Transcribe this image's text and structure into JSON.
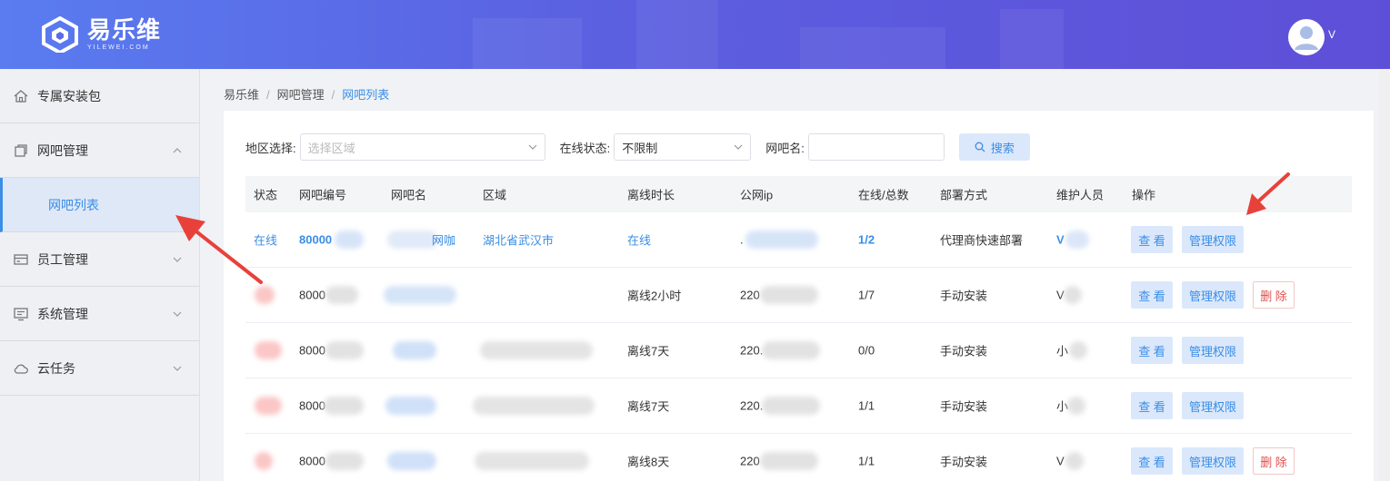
{
  "header": {
    "logo_cn": "易乐维",
    "logo_en": "YILEWEI.COM",
    "user_name": "V"
  },
  "sidebar": {
    "items": [
      {
        "label": "专属安装包",
        "icon": "home-icon"
      },
      {
        "label": "网吧管理",
        "icon": "window-icon",
        "expanded": true
      },
      {
        "label": "员工管理",
        "icon": "card-icon"
      },
      {
        "label": "系统管理",
        "icon": "monitor-icon"
      },
      {
        "label": "云任务",
        "icon": "cloud-icon"
      }
    ],
    "sub_item": "网吧列表"
  },
  "breadcrumb": [
    "易乐维",
    "网吧管理",
    "网吧列表"
  ],
  "filters": {
    "region_label": "地区选择:",
    "region_placeholder": "选择区域",
    "status_label": "在线状态:",
    "status_value": "不限制",
    "name_label": "网吧名:",
    "search_label": "搜索"
  },
  "table": {
    "headers": [
      "状态",
      "网吧编号",
      "网吧名",
      "区域",
      "离线时长",
      "公网ip",
      "在线/总数",
      "部署方式",
      "维护人员",
      "操作"
    ],
    "rows": [
      {
        "status": "在线",
        "id": "80000",
        "name": "网咖",
        "region": "湖北省武汉市",
        "offline": "在线",
        "ip": ".",
        "count": "1/2",
        "deploy": "代理商快速部署",
        "staff": "V",
        "delete": false
      },
      {
        "status": "",
        "id": "8000",
        "name": "",
        "region": "",
        "offline": "离线2小时",
        "ip": "220",
        "count": "1/7",
        "deploy": "手动安装",
        "staff": "V",
        "delete": true
      },
      {
        "status": "",
        "id": "8000",
        "name": "",
        "region": "",
        "offline": "离线7天",
        "ip": "220.",
        "count": "0/0",
        "deploy": "手动安装",
        "staff": "小",
        "delete": false
      },
      {
        "status": "",
        "id": "8000",
        "name": "",
        "region": "",
        "offline": "离线7天",
        "ip": "220.",
        "count": "1/1",
        "deploy": "手动安装",
        "staff": "小",
        "delete": false
      },
      {
        "status": "",
        "id": "8000",
        "name": "",
        "region": "",
        "offline": "离线8天",
        "ip": "220",
        "count": "1/1",
        "deploy": "手动安装",
        "staff": "V",
        "delete": true
      }
    ],
    "actions": {
      "view": "查 看",
      "perm": "管理权限",
      "delete": "删 除"
    }
  },
  "colors": {
    "accent": "#3a8ee6",
    "header_start": "#5a7cf0",
    "header_end": "#5e4fd8",
    "annotation": "#e8413a"
  }
}
